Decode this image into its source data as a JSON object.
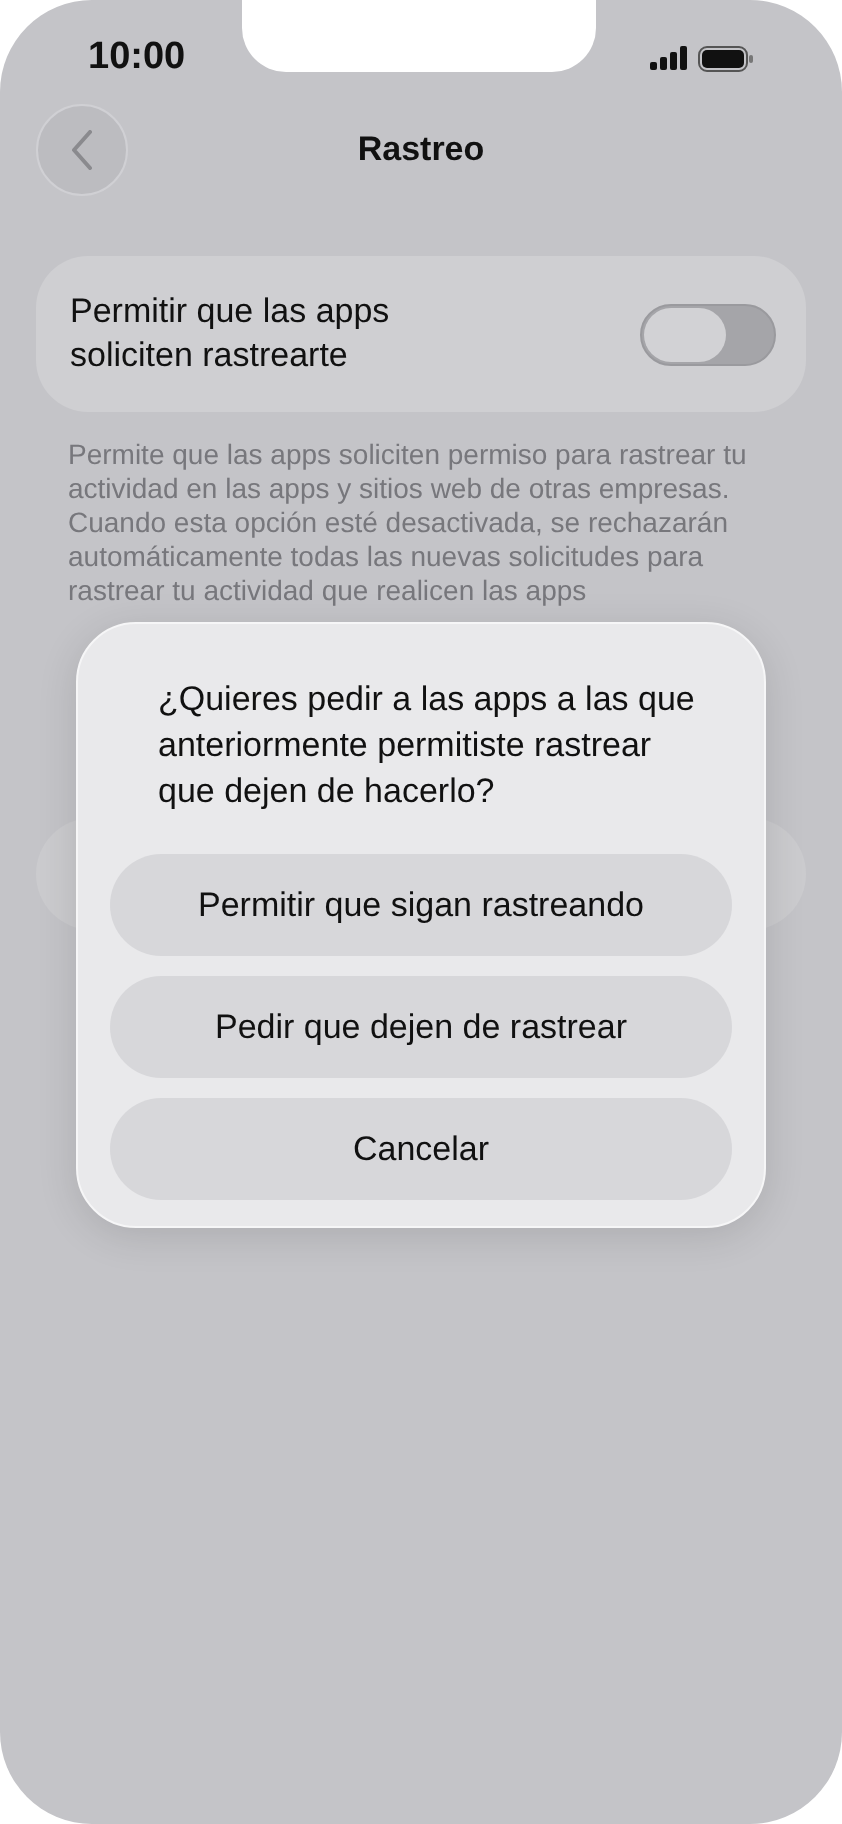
{
  "status_bar": {
    "time": "10:00"
  },
  "nav": {
    "title": "Rastreo"
  },
  "setting": {
    "label": "Permitir que las apps soliciten rastrearte",
    "on": false
  },
  "footnote": "Permite que las apps soliciten permiso para rastrear tu actividad en las apps y sitios web de otras empresas. Cuando esta opción esté desactivada, se rechazarán automáticamente todas las nuevas solicitudes para rastrear tu actividad que realicen las apps",
  "dialog": {
    "message": "¿Quieres pedir a las apps a las que anteriormente permitiste rastrear que dejen de hacerlo?",
    "buttons": [
      "Permitir que sigan rastreando",
      "Pedir que dejen de rastrear",
      "Cancelar"
    ]
  }
}
